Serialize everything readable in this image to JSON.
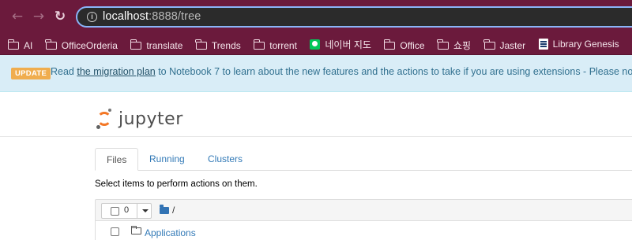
{
  "browser": {
    "url_host": "localhost",
    "url_path": ":8888/tree",
    "bookmarks": [
      {
        "label": "AI",
        "icon": "folder-icon"
      },
      {
        "label": "OfficeOrderia",
        "icon": "folder-icon"
      },
      {
        "label": "translate",
        "icon": "folder-icon"
      },
      {
        "label": "Trends",
        "icon": "folder-icon"
      },
      {
        "label": "torrent",
        "icon": "folder-icon"
      },
      {
        "label": "네이버 지도",
        "icon": "naver-map-favicon"
      },
      {
        "label": "Office",
        "icon": "folder-icon"
      },
      {
        "label": "쇼핑",
        "icon": "folder-icon"
      },
      {
        "label": "Jaster",
        "icon": "folder-icon"
      },
      {
        "label": "Library Genesis",
        "icon": "library-genesis-favicon"
      },
      {
        "label": "",
        "icon": "folder-icon"
      }
    ]
  },
  "banner": {
    "badge": "UPDATE",
    "text_before": "Read ",
    "link_text": "the migration plan",
    "text_after": " to Notebook 7 to learn about the new features and the actions to take if you are using extensions - Please note that u"
  },
  "header": {
    "logo_text": "jupyter"
  },
  "tabs": [
    {
      "label": "Files",
      "active": true
    },
    {
      "label": "Running",
      "active": false
    },
    {
      "label": "Clusters",
      "active": false
    }
  ],
  "instructions": "Select items to perform actions on them.",
  "file_list": {
    "selected_count": "0",
    "breadcrumb_sep": "/",
    "rows": [
      {
        "name": "Applications",
        "type": "folder"
      }
    ]
  },
  "colors": {
    "browser_chrome": "#6b1a3c",
    "banner_bg": "#d9edf7",
    "badge": "#f0ad4e",
    "link": "#337ab7",
    "jupyter_orange": "#f37726"
  }
}
